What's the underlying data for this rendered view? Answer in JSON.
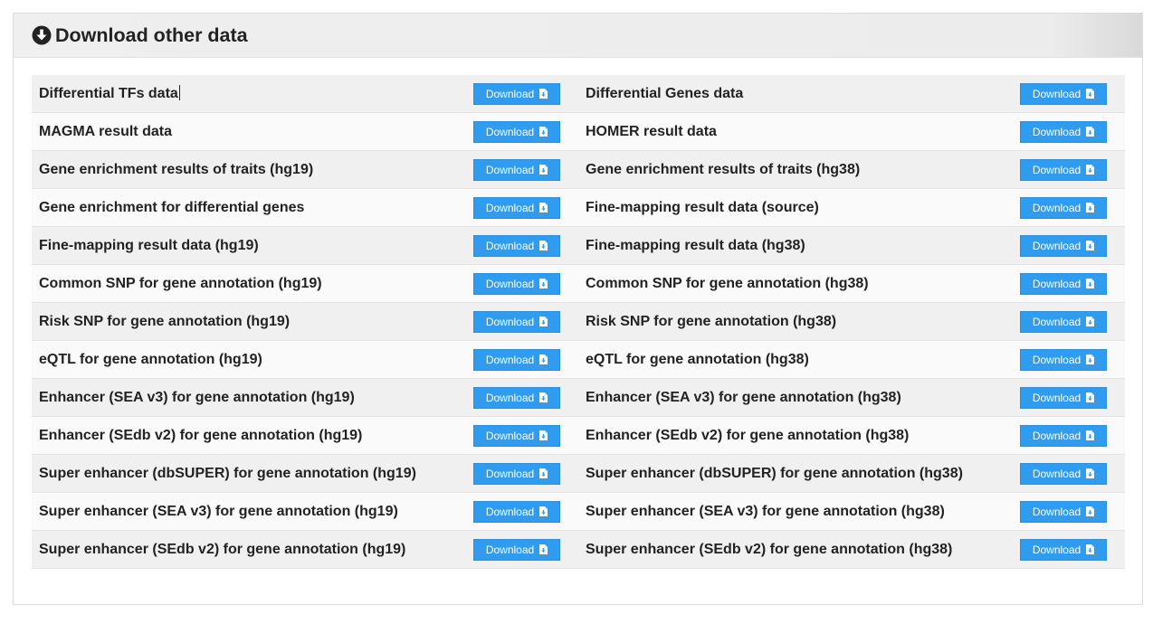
{
  "panel": {
    "title": "Download other data",
    "header_icon": "circle-arrow-down-icon"
  },
  "button": {
    "label": "Download",
    "icon": "file-download-icon",
    "color": "#2f9cf0"
  },
  "rows": [
    {
      "left": "Differential TFs data",
      "right": "Differential Genes data"
    },
    {
      "left": "MAGMA result data",
      "right": "HOMER result data"
    },
    {
      "left": "Gene enrichment results of traits (hg19)",
      "right": "Gene enrichment results of traits (hg38)"
    },
    {
      "left": "Gene enrichment for differential genes",
      "right": "Fine-mapping result data (source)"
    },
    {
      "left": "Fine-mapping result data (hg19)",
      "right": "Fine-mapping result data (hg38)"
    },
    {
      "left": "Common SNP for gene annotation (hg19)",
      "right": "Common SNP for gene annotation (hg38)"
    },
    {
      "left": "Risk SNP for gene annotation (hg19)",
      "right": "Risk SNP for gene annotation (hg38)"
    },
    {
      "left": "eQTL for gene annotation (hg19)",
      "right": "eQTL for gene annotation (hg38)"
    },
    {
      "left": "Enhancer (SEA v3) for gene annotation (hg19)",
      "right": "Enhancer (SEA v3) for gene annotation (hg38)"
    },
    {
      "left": "Enhancer (SEdb v2) for gene annotation (hg19)",
      "right": "Enhancer (SEdb v2) for gene annotation (hg38)"
    },
    {
      "left": "Super enhancer (dbSUPER) for gene annotation (hg19)",
      "right": "Super enhancer (dbSUPER) for gene annotation (hg38)"
    },
    {
      "left": "Super enhancer (SEA v3) for gene annotation (hg19)",
      "right": "Super enhancer (SEA v3) for gene annotation (hg38)"
    },
    {
      "left": "Super enhancer (SEdb v2) for gene annotation (hg19)",
      "right": "Super enhancer (SEdb v2) for gene annotation (hg38)"
    }
  ]
}
